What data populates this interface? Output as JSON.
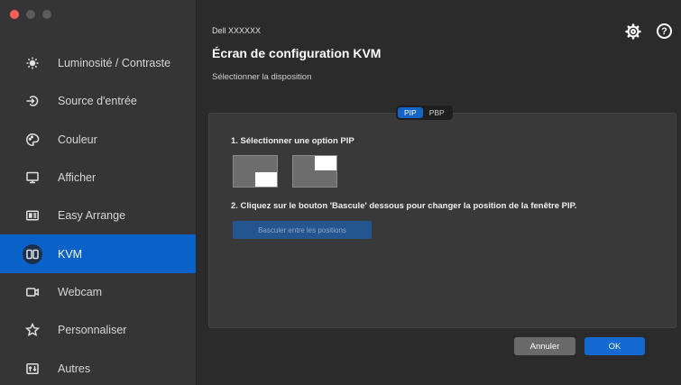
{
  "sidebar": {
    "items": [
      {
        "label": "Luminosité / Contraste",
        "icon": "brightness-icon"
      },
      {
        "label": "Source d'entrée",
        "icon": "input-source-icon"
      },
      {
        "label": "Couleur",
        "icon": "color-palette-icon"
      },
      {
        "label": "Afficher",
        "icon": "monitor-icon"
      },
      {
        "label": "Easy Arrange",
        "icon": "easy-arrange-icon"
      },
      {
        "label": "KVM",
        "icon": "kvm-icon",
        "active": true
      },
      {
        "label": "Webcam",
        "icon": "webcam-icon"
      },
      {
        "label": "Personnaliser",
        "icon": "star-icon"
      },
      {
        "label": "Autres",
        "icon": "others-icon"
      }
    ]
  },
  "header": {
    "device": "Dell XXXXXX",
    "title": "Écran de configuration KVM",
    "subtitle": "Sélectionner la disposition",
    "help_glyph": "?"
  },
  "tabs": [
    {
      "label": "PIP",
      "active": true
    },
    {
      "label": "PBP",
      "active": false
    }
  ],
  "content": {
    "step1": "1. Sélectionner une option PIP",
    "step2": "2. Cliquez sur le bouton 'Bascule' dessous pour changer la position de la fenêtre PIP.",
    "toggle_label": "Basculer entre les positions"
  },
  "footer": {
    "cancel_label": "Annuler",
    "ok_label": "OK"
  },
  "colors": {
    "accent": "#0a62c9",
    "sidebar_bg": "#353535",
    "main_bg": "#2b2b2b",
    "panel_bg": "#393939"
  }
}
